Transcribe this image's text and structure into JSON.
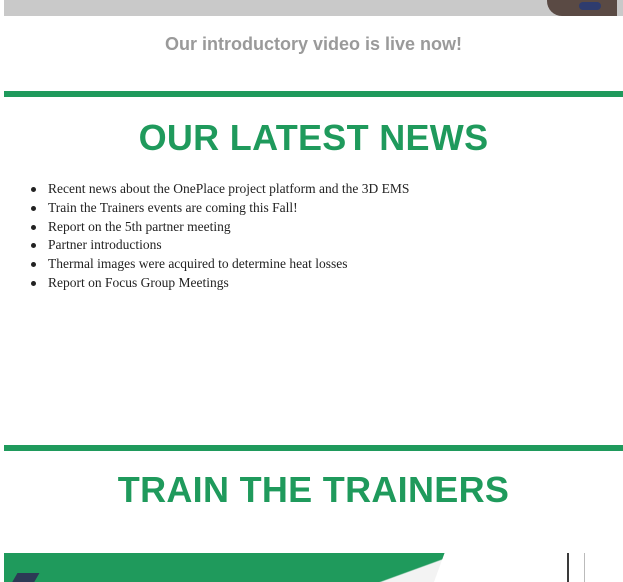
{
  "video": {
    "caption": "Our introductory video is live now!"
  },
  "news": {
    "title": "OUR LATEST NEWS",
    "items": [
      {
        "label": "Recent news about the OnePlace project platform and the 3D EMS"
      },
      {
        "label": "Train the Trainers events are coming this Fall!"
      },
      {
        "label": "Report on the 5th partner meeting"
      },
      {
        "label": "Partner introductions"
      },
      {
        "label": "Thermal images were acquired to determine heat losses"
      },
      {
        "label": "Report on Focus Group Meetings"
      }
    ]
  },
  "trainers": {
    "title": "TRAIN THE TRAINERS"
  },
  "colors": {
    "accent_green": "#1f9a5c",
    "caption_gray": "#9a9a9a",
    "text": "#222222"
  }
}
